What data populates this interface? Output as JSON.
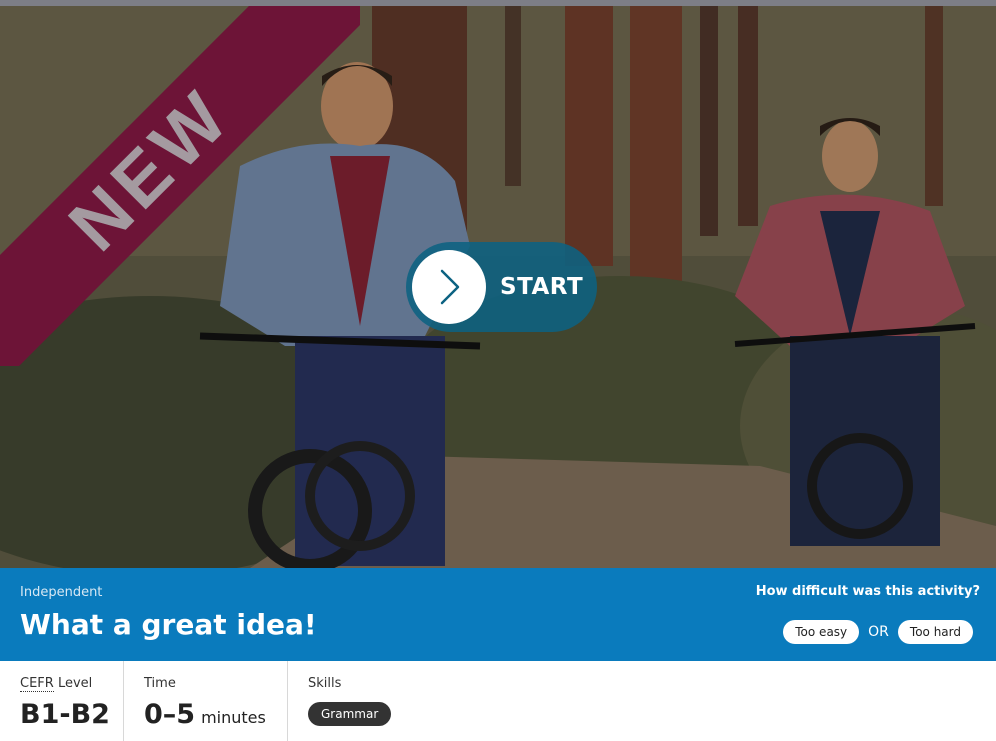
{
  "hero": {
    "badge": "NEW",
    "start_label": "START",
    "image_icon": "cyclists-photo"
  },
  "activity": {
    "category": "Independent",
    "title": "What a great idea!"
  },
  "difficulty": {
    "question": "How difficult was this activity?",
    "easy_label": "Too easy",
    "separator": "OR",
    "hard_label": "Too hard"
  },
  "meta": {
    "level_abbr": "CEFR",
    "level_label": "Level",
    "level_value": "B1-B2",
    "time_label": "Time",
    "time_value": "0–5",
    "time_unit": "minutes",
    "skills_label": "Skills",
    "skills": [
      "Grammar"
    ]
  },
  "colors": {
    "ribbon": "#6d1437",
    "band": "#0a7bbd",
    "start_button": "#0c6282"
  }
}
